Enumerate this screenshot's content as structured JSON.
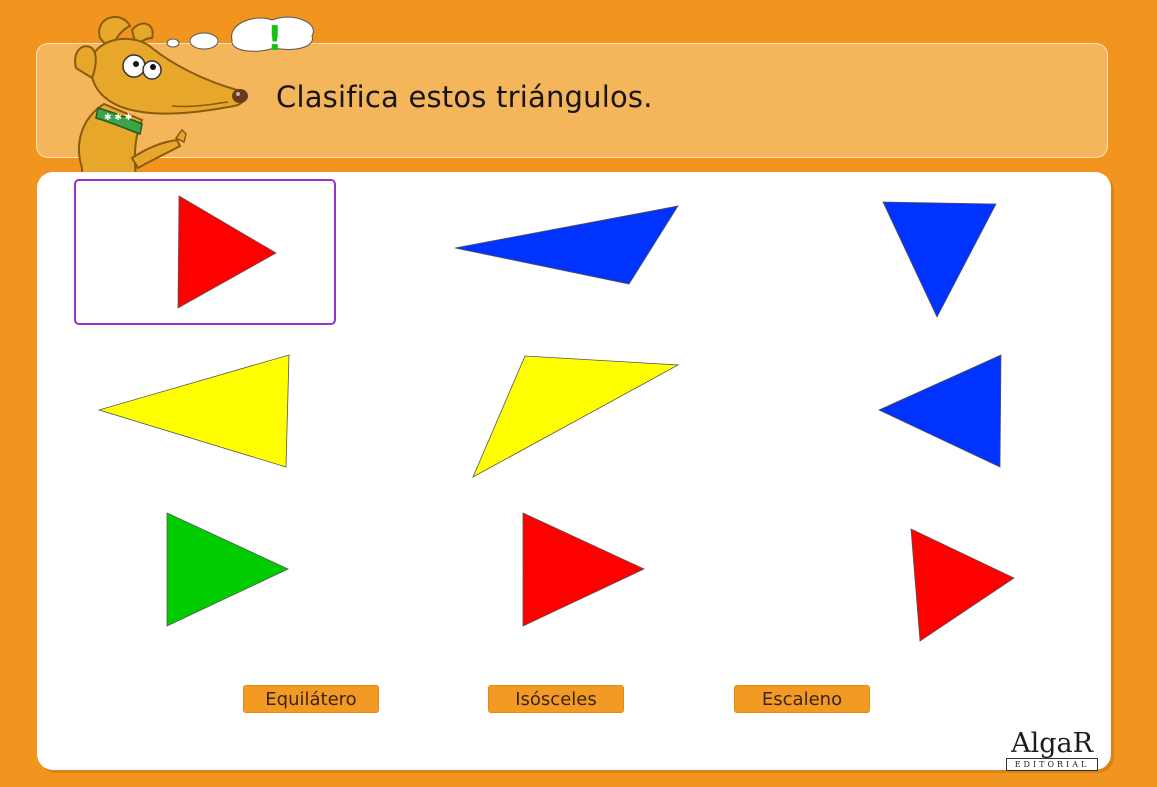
{
  "header": {
    "title": "Clasifica estos triángulos."
  },
  "colors": {
    "red": "#ff0000",
    "blue": "#0033ff",
    "yellow": "#ffff00",
    "green": "#00cc00",
    "selection": "#9932cc",
    "accent": "#f39a25"
  },
  "triangles": [
    {
      "color": "red",
      "selected": true
    },
    {
      "color": "blue"
    },
    {
      "color": "blue"
    },
    {
      "color": "yellow"
    },
    {
      "color": "yellow"
    },
    {
      "color": "blue"
    },
    {
      "color": "green"
    },
    {
      "color": "red"
    },
    {
      "color": "red"
    }
  ],
  "buttons": {
    "equilatero": "Equilátero",
    "isosceles": "Isósceles",
    "escaleno": "Escaleno"
  },
  "mascot": {
    "speech": "!"
  },
  "logo": {
    "name": "AlgaR",
    "sub": "EDITORIAL"
  }
}
